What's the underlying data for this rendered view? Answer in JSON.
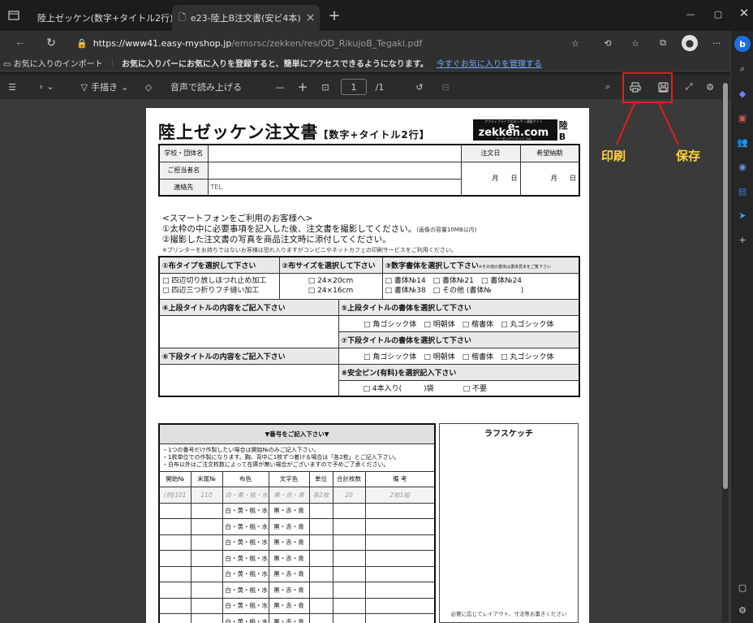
{
  "tabs": [
    {
      "title": "陸上ゼッケン(数字+タイトル2行) | ≪",
      "active": false
    },
    {
      "title": "e23-陸上B注文書(安ビ4本)",
      "active": true
    }
  ],
  "address": {
    "url_host": "https://www41.easy-myshop.jp",
    "url_path": "/emsrsc/zekken/res/OD_RikujoB_Tegaki.pdf"
  },
  "favorites": {
    "import": "お気に入りのインポート",
    "prompt": "お気に入りバーにお気に入りを登録すると、簡単にアクセスできるようになります。",
    "manage_link": "今すぐお気に入りを管理する"
  },
  "pdf_toolbar": {
    "draw": "手描き",
    "read_aloud": "音声で読み上げる",
    "page_current": "1",
    "page_total": "/1"
  },
  "annotations": {
    "print": "印刷",
    "save": "保存"
  },
  "doc": {
    "title": "陸上ゼッケン注文書",
    "title_sub": "【数字+タイトル2行】",
    "logo": {
      "tagline": "アクティブライフのゼッケン通販サイト",
      "brand": "e-zekken.com",
      "kana": "イーゼッケンドットコム",
      "tag": "陸B"
    },
    "fields": {
      "school": "学校・団体名",
      "person": "ご担当者名",
      "contact": "連絡先",
      "tel": "TEL",
      "order_date": "注文日",
      "desired_date": "希望納期",
      "month": "月",
      "day": "日"
    },
    "notice": {
      "head": "<スマートフォンをご利用のお客様へ>",
      "l1": "①太枠の中に必要事項を記入した後、注文書を撮影してください。",
      "l1s": "(画像の容量10MB以内)",
      "l2": "②撮影した注文書の写真を商品注文時に添付してください。",
      "l3": "※プリンターをお持ちではないお客様は恐れ入りますがコンビニやネットカフェの印刷サービスをご利用ください。"
    },
    "section1": {
      "h1": "①布タイプを選択して下さい",
      "h2": "②布サイズを選択して下さい",
      "h3": "③数字書体を選択して下さい",
      "h3s": "※その他の書体は書体見本をご覧下さい",
      "cloth1": "□ 四辺切り放しほつれ止め加工",
      "cloth2": "□ 四辺三つ折りフチ縫い加工",
      "size1": "□ 24×20cm",
      "size2": "□ 24×16cm",
      "font1": "□ 書体№14　□ 書体№21　□ 書体№24",
      "font2": "□ 書体№38　□ その他 (書体№　　　　)"
    },
    "section2": {
      "upper_title": "④上段タイトルの内容をご記入下さい",
      "upper_font": "⑤上段タイトルの書体を選択して下さい",
      "font_opts": "□ 角ゴシック体　□ 明朝体　□ 楷書体　□ 丸ゴシック体",
      "lower_font": "⑦下段タイトルの書体を選択して下さい",
      "lower_title": "⑥下段タイトルの内容をご記入下さい",
      "pin": "⑧安全ピン(有料)を選択記入下さい",
      "pin_opts": "□ 4本入り(　　　)袋　　　　□ 不要"
    },
    "numbers": {
      "head": "▼番号をご記入下さい▼",
      "n1": "・1つの番号だけ作製したい場合は開始№のみご記入下さい。",
      "n2": "・1枚単位での作製になります。胸、背中に1枚ずつ着ける場合は「各2枚」とご記入下さい。",
      "n3": "・白布以外はご注文枚数によって在庫が無い場合がございますので予めご了承ください。",
      "cols": [
        "開始№",
        "末尾№",
        "布色",
        "文字色",
        "単位",
        "合計枚数",
        "備 考"
      ],
      "example": [
        "(例)101",
        "110",
        "白・黄・桃・水",
        "黒・赤・青",
        "各2枚",
        "20",
        "2枚1組"
      ],
      "cloth_colors": "白・黄・桃・水",
      "text_colors": "黒・赤・青"
    },
    "sketch": {
      "head": "ラフスケッチ",
      "foot": "必要に応じてレイアウト、寸法等お書きください"
    }
  }
}
